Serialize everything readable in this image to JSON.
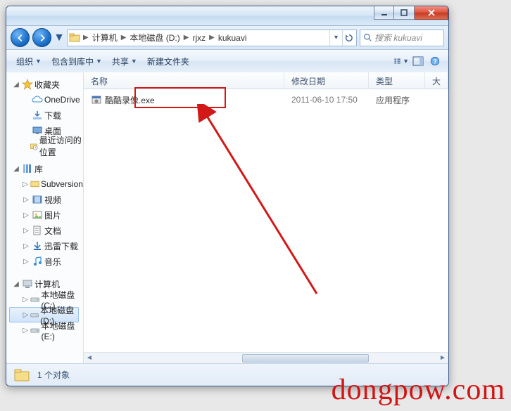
{
  "titlebar": {},
  "breadcrumb": {
    "seg0": "计算机",
    "seg1": "本地磁盘 (D:)",
    "seg2": "rjxz",
    "seg3": "kukuavi"
  },
  "search": {
    "placeholder": "搜索 kukuavi"
  },
  "toolbar": {
    "organize": "组织",
    "include": "包含到库中",
    "share": "共享",
    "newfolder": "新建文件夹"
  },
  "columns": {
    "name": "名称",
    "date": "修改日期",
    "type": "类型",
    "size": "大小"
  },
  "sidebar": {
    "fav_header": "收藏夹",
    "fav": {
      "onedrive": "OneDrive",
      "downloads": "下载",
      "desktop": "桌面",
      "recent": "最近访问的位置"
    },
    "lib_header": "库",
    "lib": {
      "subversion": "Subversion",
      "video": "视频",
      "pictures": "图片",
      "documents": "文档",
      "xunlei": "迅雷下载",
      "music": "音乐"
    },
    "comp_header": "计算机",
    "comp": {
      "c": "本地磁盘 (C:)",
      "d": "本地磁盘 (D:)",
      "e": "本地磁盘 (E:)"
    }
  },
  "files": [
    {
      "name": "酷酷录像.exe",
      "date": "2011-06-10 17:50",
      "type": "应用程序",
      "size": ""
    }
  ],
  "status": {
    "count": "1 个对象"
  },
  "watermark": "dongpow.com"
}
